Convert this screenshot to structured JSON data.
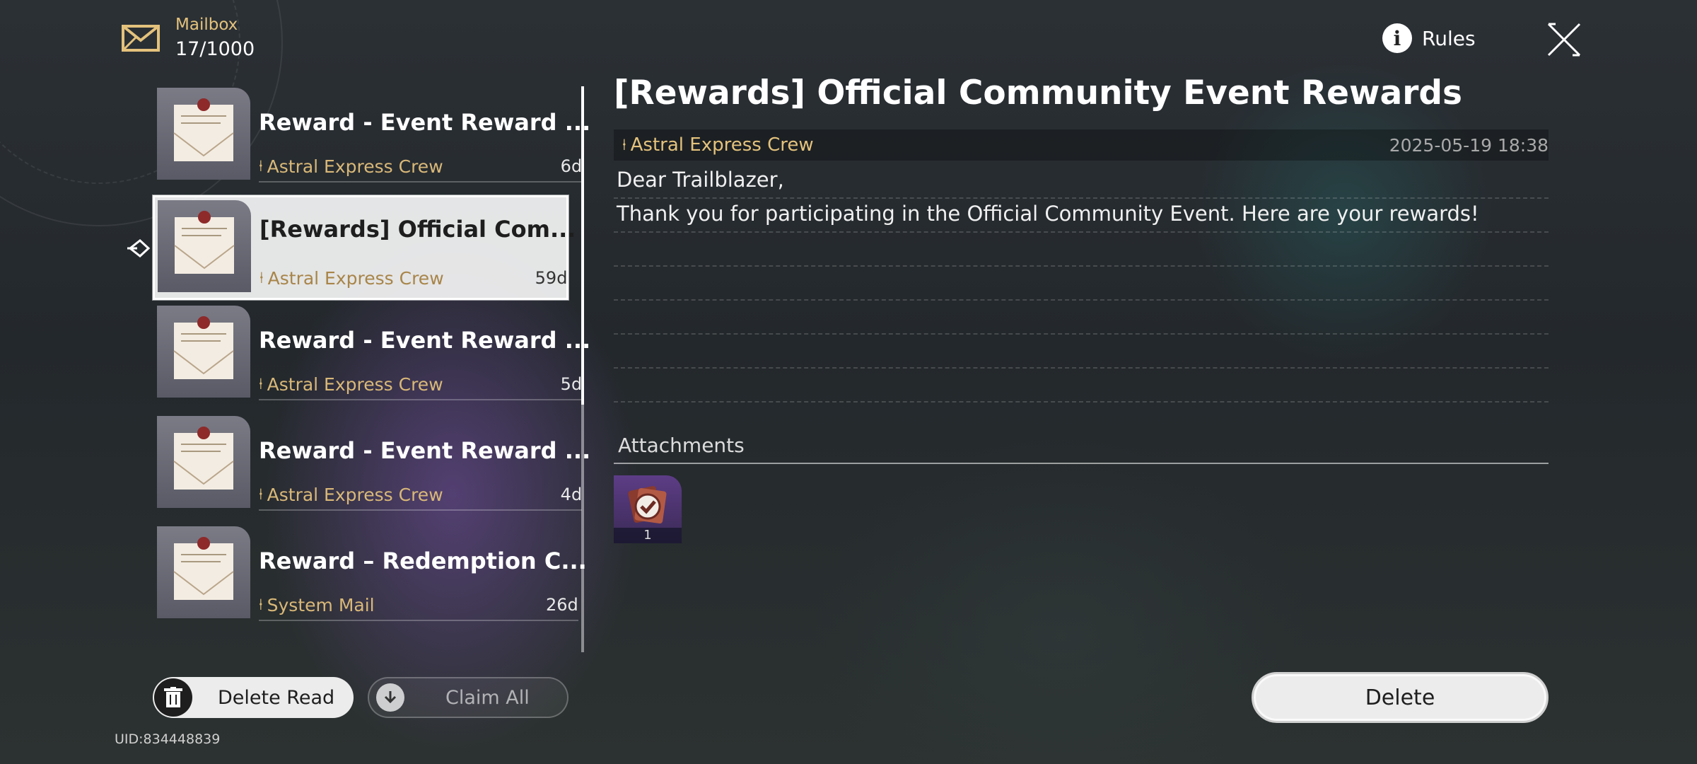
{
  "header": {
    "mailbox_label": "Mailbox",
    "mail_count": "17/1000",
    "rules_label": "Rules"
  },
  "mails": [
    {
      "title": "Reward - Event Reward ...",
      "sender": "Astral Express Crew",
      "age": "6d",
      "selected": false
    },
    {
      "title": "[Rewards] Official Com...",
      "sender": "Astral Express Crew",
      "age": "59d",
      "selected": true
    },
    {
      "title": "Reward - Event Reward ...",
      "sender": "Astral Express Crew",
      "age": "5d",
      "selected": false
    },
    {
      "title": "Reward - Event Reward ...",
      "sender": "Astral Express Crew",
      "age": "4d",
      "selected": false
    },
    {
      "title": "Reward – Redemption C...",
      "sender": "System Mail",
      "age": "26d",
      "selected": false
    }
  ],
  "buttons": {
    "delete_read": "Delete Read",
    "claim_all": "Claim All",
    "delete": "Delete"
  },
  "uid": "UID:834448839",
  "detail": {
    "title": "[Rewards] Official Community Event Rewards",
    "sender": "Astral Express Crew",
    "date": "2025-05-19 18:38",
    "body": [
      "Dear Trailblazer,",
      "Thank you for participating in the Official Community Event. Here are your rewards!",
      "",
      "",
      "",
      "",
      ""
    ],
    "attachments_label": "Attachments",
    "attachments": [
      {
        "icon": "reward-badge-icon",
        "count": "1"
      }
    ]
  },
  "colors": {
    "accent_gold": "#e4c27c",
    "selected_bg": "#ececec"
  }
}
